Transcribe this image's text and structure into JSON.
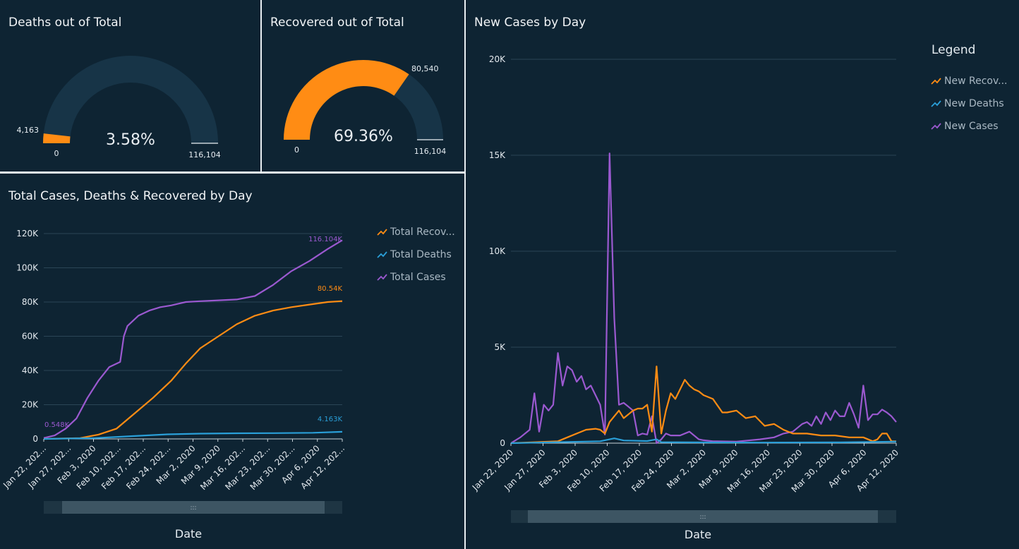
{
  "colors": {
    "background": "#0e2433",
    "orange": "#ff8c14",
    "blue": "#2a9fd8",
    "purple": "#9b59d0",
    "gauge_track": "#173447",
    "grid": "#2b4556"
  },
  "deaths_gauge": {
    "title": "Deaths out of Total",
    "value_label": "4,163",
    "percent_label": "3.58%",
    "min_label": "0",
    "max_label": "116,104",
    "fraction": 0.0358
  },
  "recovered_gauge": {
    "title": "Recovered out of Total",
    "value_label": "80,540",
    "percent_label": "69.36%",
    "min_label": "0",
    "max_label": "116,104",
    "fraction": 0.6936
  },
  "total_chart": {
    "title": "Total Cases, Deaths & Recovered by Day",
    "axis_title": "Date",
    "scroll_grip": ":::",
    "y_ticks": [
      "0",
      "20K",
      "40K",
      "60K",
      "80K",
      "100K",
      "120K"
    ],
    "x_ticks": [
      "Jan 22, 202...",
      "Jan 27, 202...",
      "Feb 3, 2020",
      "Feb 10, 202...",
      "Feb 17, 202...",
      "Feb 24, 202...",
      "Mar 2, 2020",
      "Mar 9, 2020",
      "Mar 16, 202...",
      "Mar 23, 202...",
      "Mar 30, 202...",
      "Apr 6, 2020",
      "Apr 12, 202..."
    ],
    "annotations": {
      "start_cases": "0.548K",
      "end_cases": "116.104K",
      "end_recovered": "80.54K",
      "end_deaths": "4.163K"
    },
    "legend": [
      "Total Recov...",
      "Total Deaths",
      "Total Cases"
    ]
  },
  "new_chart": {
    "title": "New Cases by Day",
    "axis_title": "Date",
    "legend_title": "Legend",
    "scroll_grip": ":::",
    "y_ticks": [
      "0",
      "5K",
      "10K",
      "15K",
      "20K"
    ],
    "x_ticks": [
      "Jan 22, 2020",
      "Jan 27, 2020",
      "Feb 3, 2020",
      "Feb 10, 2020",
      "Feb 17, 2020",
      "Feb 24, 2020",
      "Mar 2, 2020",
      "Mar 9, 2020",
      "Mar 16, 2020",
      "Mar 23, 2020",
      "Mar 30, 2020",
      "Apr 6, 2020",
      "Apr 12, 2020"
    ],
    "legend": [
      "New Recov...",
      "New Deaths",
      "New Cases"
    ]
  },
  "chart_data": [
    {
      "type": "line",
      "title": "Total Cases, Deaths & Recovered by Day",
      "xlabel": "Date",
      "ylabel": "",
      "ylim": [
        0,
        120000
      ],
      "x_range": [
        "2020-01-22",
        "2020-04-13"
      ],
      "legend_position": "top-right",
      "series": [
        {
          "name": "Total Cases",
          "color": "#9b59d0",
          "x": [
            "2020-01-22",
            "2020-01-25",
            "2020-01-28",
            "2020-01-31",
            "2020-02-03",
            "2020-02-06",
            "2020-02-09",
            "2020-02-12",
            "2020-02-13",
            "2020-02-14",
            "2020-02-17",
            "2020-02-20",
            "2020-02-23",
            "2020-02-26",
            "2020-03-01",
            "2020-03-05",
            "2020-03-10",
            "2020-03-15",
            "2020-03-20",
            "2020-03-25",
            "2020-03-30",
            "2020-04-04",
            "2020-04-09",
            "2020-04-13"
          ],
          "y": [
            548,
            2000,
            6000,
            12000,
            24000,
            34000,
            42000,
            45000,
            60000,
            66000,
            72000,
            75000,
            77000,
            78000,
            80000,
            80500,
            81000,
            81500,
            83500,
            90000,
            98000,
            104000,
            111000,
            116104
          ]
        },
        {
          "name": "Total Recovered",
          "color": "#ff8c14",
          "x": [
            "2020-01-22",
            "2020-02-01",
            "2020-02-06",
            "2020-02-11",
            "2020-02-16",
            "2020-02-21",
            "2020-02-26",
            "2020-03-01",
            "2020-03-05",
            "2020-03-10",
            "2020-03-15",
            "2020-03-20",
            "2020-03-25",
            "2020-03-30",
            "2020-04-04",
            "2020-04-09",
            "2020-04-13"
          ],
          "y": [
            0,
            500,
            2500,
            6000,
            15000,
            24000,
            34000,
            44000,
            53000,
            60000,
            67000,
            72000,
            75000,
            77000,
            78500,
            80000,
            80540
          ]
        },
        {
          "name": "Total Deaths",
          "color": "#2a9fd8",
          "x": [
            "2020-01-22",
            "2020-02-05",
            "2020-02-15",
            "2020-02-25",
            "2020-03-05",
            "2020-03-15",
            "2020-03-25",
            "2020-04-05",
            "2020-04-13"
          ],
          "y": [
            17,
            500,
            1600,
            2700,
            3100,
            3300,
            3400,
            3600,
            4163
          ]
        }
      ]
    },
    {
      "type": "line",
      "title": "New Cases by Day",
      "xlabel": "Date",
      "ylabel": "",
      "ylim": [
        0,
        20000
      ],
      "x_range": [
        "2020-01-22",
        "2020-04-13"
      ],
      "legend_position": "top-right",
      "series": [
        {
          "name": "New Cases",
          "color": "#9b59d0",
          "x": [
            "2020-01-22",
            "2020-01-24",
            "2020-01-26",
            "2020-01-27",
            "2020-01-28",
            "2020-01-29",
            "2020-01-30",
            "2020-01-31",
            "2020-02-01",
            "2020-02-02",
            "2020-02-03",
            "2020-02-04",
            "2020-02-05",
            "2020-02-06",
            "2020-02-07",
            "2020-02-08",
            "2020-02-09",
            "2020-02-10",
            "2020-02-11",
            "2020-02-12",
            "2020-02-13",
            "2020-02-14",
            "2020-02-15",
            "2020-02-16",
            "2020-02-17",
            "2020-02-18",
            "2020-02-19",
            "2020-02-20",
            "2020-02-21",
            "2020-02-22",
            "2020-02-23",
            "2020-02-24",
            "2020-02-25",
            "2020-02-27",
            "2020-02-29",
            "2020-03-02",
            "2020-03-03",
            "2020-03-05",
            "2020-03-10",
            "2020-03-15",
            "2020-03-18",
            "2020-03-20",
            "2020-03-22",
            "2020-03-24",
            "2020-03-25",
            "2020-03-26",
            "2020-03-27",
            "2020-03-28",
            "2020-03-29",
            "2020-03-30",
            "2020-03-31",
            "2020-04-01",
            "2020-04-02",
            "2020-04-03",
            "2020-04-04",
            "2020-04-05",
            "2020-04-06",
            "2020-04-07",
            "2020-04-08",
            "2020-04-09",
            "2020-04-10",
            "2020-04-11",
            "2020-04-12",
            "2020-04-13"
          ],
          "y": [
            0,
            300,
            700,
            2600,
            600,
            2000,
            1700,
            2000,
            4700,
            3000,
            4000,
            3800,
            3200,
            3500,
            2800,
            3000,
            2500,
            2000,
            450,
            15100,
            6500,
            2000,
            2100,
            1900,
            1700,
            400,
            500,
            450,
            1400,
            0,
            200,
            500,
            400,
            400,
            600,
            200,
            150,
            100,
            80,
            200,
            300,
            500,
            600,
            1000,
            1100,
            900,
            1400,
            1000,
            1600,
            1200,
            1700,
            1400,
            1400,
            2100,
            1500,
            800,
            3000,
            1200,
            1500,
            1500,
            1750,
            1600,
            1400,
            1100
          ]
        },
        {
          "name": "New Recovered",
          "color": "#ff8c14",
          "x": [
            "2020-01-22",
            "2020-02-01",
            "2020-02-03",
            "2020-02-05",
            "2020-02-07",
            "2020-02-09",
            "2020-02-10",
            "2020-02-11",
            "2020-02-12",
            "2020-02-14",
            "2020-02-15",
            "2020-02-16",
            "2020-02-17",
            "2020-02-18",
            "2020-02-19",
            "2020-02-20",
            "2020-02-21",
            "2020-02-22",
            "2020-02-23",
            "2020-02-24",
            "2020-02-25",
            "2020-02-26",
            "2020-02-27",
            "2020-02-28",
            "2020-02-29",
            "2020-03-01",
            "2020-03-02",
            "2020-03-03",
            "2020-03-05",
            "2020-03-07",
            "2020-03-08",
            "2020-03-10",
            "2020-03-12",
            "2020-03-14",
            "2020-03-16",
            "2020-03-18",
            "2020-03-20",
            "2020-03-22",
            "2020-03-25",
            "2020-03-28",
            "2020-03-31",
            "2020-04-03",
            "2020-04-06",
            "2020-04-08",
            "2020-04-09",
            "2020-04-10",
            "2020-04-11",
            "2020-04-12",
            "2020-04-13"
          ],
          "y": [
            0,
            100,
            300,
            500,
            700,
            750,
            700,
            500,
            1100,
            1700,
            1300,
            1500,
            1700,
            1800,
            1800,
            2000,
            600,
            4000,
            500,
            1700,
            2600,
            2300,
            2800,
            3300,
            3000,
            2800,
            2700,
            2500,
            2300,
            1600,
            1600,
            1700,
            1300,
            1400,
            900,
            1000,
            700,
            500,
            500,
            400,
            400,
            300,
            300,
            100,
            200,
            500,
            500,
            100,
            100
          ]
        },
        {
          "name": "New Deaths",
          "color": "#2a9fd8",
          "x": [
            "2020-01-22",
            "2020-02-01",
            "2020-02-10",
            "2020-02-13",
            "2020-02-15",
            "2020-02-20",
            "2020-02-22",
            "2020-02-23",
            "2020-03-01",
            "2020-03-15",
            "2020-04-01",
            "2020-04-13"
          ],
          "y": [
            0,
            50,
            100,
            250,
            140,
            110,
            200,
            50,
            40,
            30,
            40,
            80
          ]
        }
      ]
    }
  ]
}
